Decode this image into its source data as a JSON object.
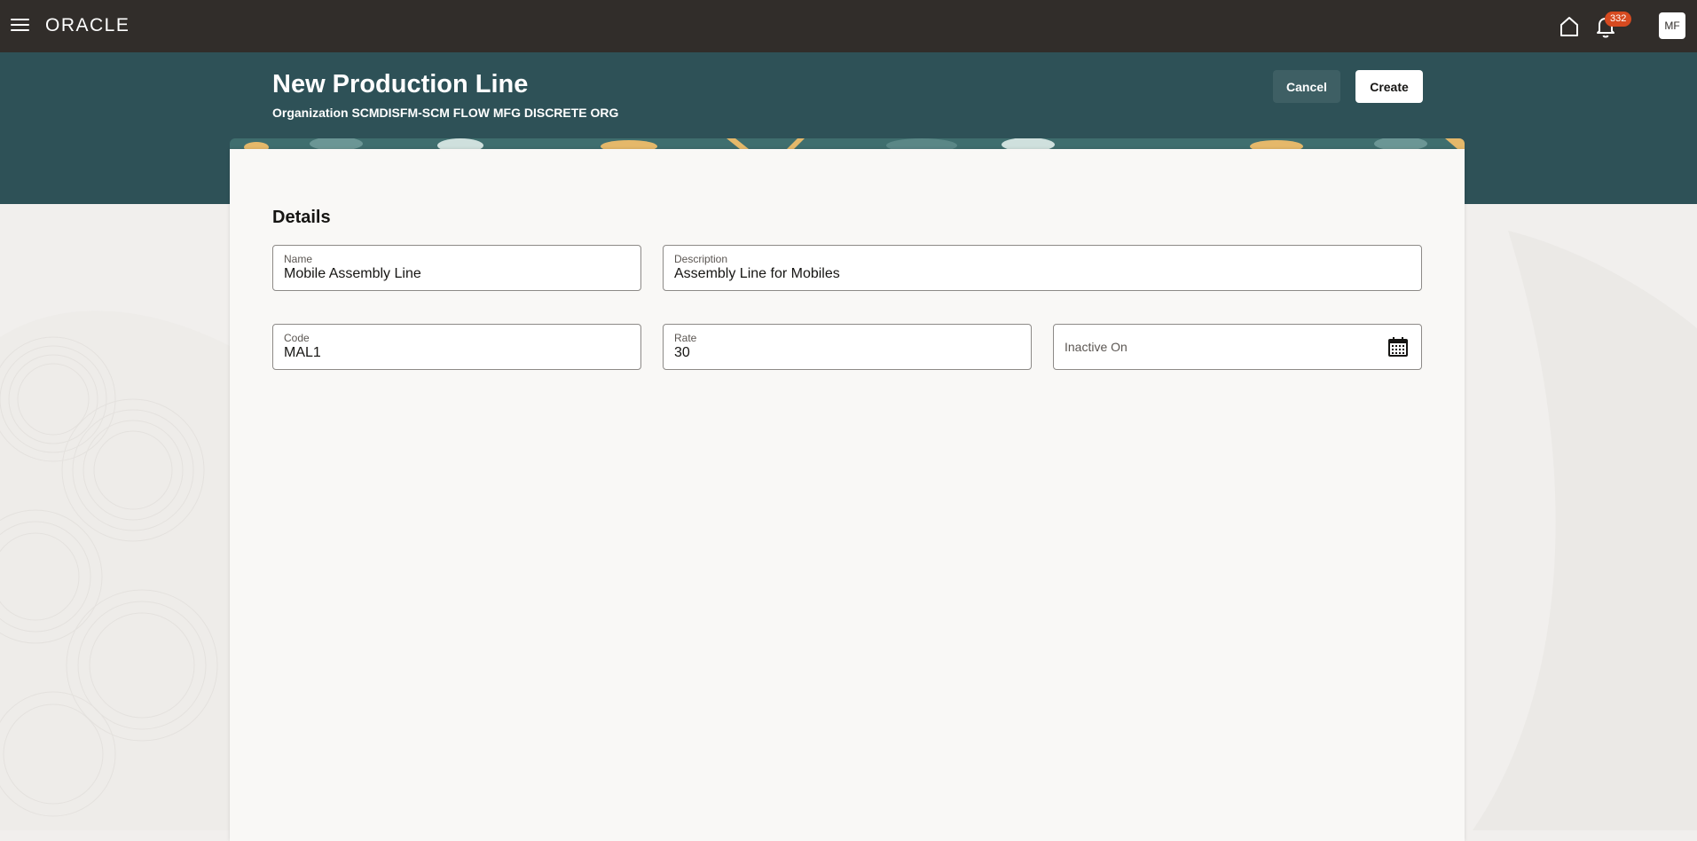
{
  "topbar": {
    "logo": "ORACLE",
    "notification_count": "332",
    "avatar_initials": "MF",
    "icons": [
      "hamburger-menu-icon",
      "home-icon",
      "bell-icon"
    ]
  },
  "header": {
    "title": "New Production Line",
    "subtitle": "Organization SCMDISFM-SCM FLOW MFG DISCRETE ORG",
    "cancel_label": "Cancel",
    "create_label": "Create"
  },
  "details": {
    "section_title": "Details",
    "name": {
      "label": "Name",
      "value": "Mobile Assembly Line"
    },
    "description": {
      "label": "Description",
      "value": "Assembly Line for Mobiles"
    },
    "code": {
      "label": "Code",
      "value": "MAL1"
    },
    "rate": {
      "label": "Rate",
      "value": "30"
    },
    "inactive_on": {
      "label": "Inactive On",
      "value": ""
    }
  },
  "colors": {
    "topbar": "#312d2a",
    "header_band": "#2e5157",
    "badge": "#d64a20",
    "card": "#f9f8f6"
  }
}
